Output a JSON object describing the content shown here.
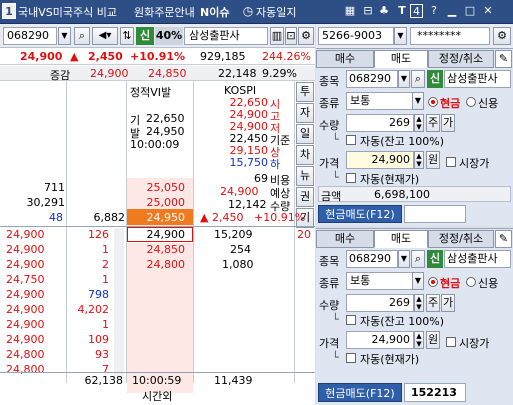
{
  "topbar": {
    "num": "1",
    "compare": "국내VS미국주식 비교",
    "won": "원화주문안내",
    "news": "N이슈",
    "autolog": "자동일지",
    "help_num": "4",
    "help_q": "?"
  },
  "left": {
    "code": "068290",
    "credit": "신",
    "pct": "40%",
    "name": "삼성출판사",
    "price": "24,900",
    "change": "2,450",
    "rate": "+10.91%",
    "volume": "929,185",
    "vol_rate": "244.26%",
    "label_change": "증감",
    "ask_px": "24,900",
    "bid_px": "24,850",
    "vol2": "22,148",
    "vol2_rate": "9.29%",
    "vi_title": "정적VI발",
    "vi_gi_label": "기",
    "vi_gi": "22,650",
    "vi_bal_label": "발",
    "vi_bal": "24,950",
    "vi_time": "10:00:09",
    "kospi": "KOSPI",
    "kospi_vals": [
      "22,650",
      "24,900",
      "24,900",
      "22,450",
      "29,150",
      "15,750",
      "69"
    ],
    "kospi_labels": [
      "시",
      "고",
      "저",
      "기준",
      "상",
      "하",
      "비용"
    ],
    "expected_label": "예상",
    "expected_val": "24,900",
    "qty_label": "수량",
    "qty_val": "12,142",
    "exp_change": "2,450",
    "exp_rate": "+10.91%",
    "side_tabs": [
      "투",
      "자",
      "일",
      "차",
      "뉴",
      "권",
      "기"
    ],
    "asks": [
      {
        "qty": "711",
        "price": "25,050"
      },
      {
        "qty": "30,291",
        "price": "25,000"
      },
      {
        "prev": "48",
        "qty": "6,882",
        "price": "24,950"
      }
    ],
    "current_price": "24,900",
    "current_qty": "15,209",
    "current_right": "20",
    "bids": [
      {
        "price": "24,850",
        "qty": "254"
      },
      {
        "price": "24,800",
        "qty": "1,080"
      }
    ],
    "ticks": [
      {
        "p": "24,900",
        "q": "126"
      },
      {
        "p": "24,900",
        "q": "1"
      },
      {
        "p": "24,900",
        "q": "2"
      },
      {
        "p": "24,750",
        "q": "1"
      },
      {
        "p": "24,900",
        "q": "798"
      },
      {
        "p": "24,900",
        "q": "4,202"
      },
      {
        "p": "24,900",
        "q": "1"
      },
      {
        "p": "24,900",
        "q": "109"
      },
      {
        "p": "24,800",
        "q": "93"
      },
      {
        "p": "24,800",
        "q": "7"
      }
    ],
    "total_ask": "62,138",
    "time": "10:00:59",
    "after_hours": "시간외",
    "total_bid": "11,439"
  },
  "order_top": {
    "account": "5266-9003",
    "password": "********",
    "tab_buy": "매수",
    "tab_sell": "매도",
    "tab_modify": "정정/취소",
    "label_code": "종목",
    "code": "068290",
    "credit": "신",
    "name": "삼성출판사",
    "label_type": "종류",
    "type": "보통",
    "radio_cash": "현금",
    "radio_credit": "신용",
    "label_qty": "수량",
    "qty": "269",
    "btn_ju": "주",
    "btn_ga": "가",
    "auto_qty": "자동(잔고 100%)",
    "label_price": "가격",
    "price": "24,900",
    "won": "원",
    "market_price": "시장가",
    "auto_price": "자동(현재가)",
    "label_amount": "금액",
    "amount": "6,698,100",
    "submit": "현금매도(F12)"
  },
  "order_bottom": {
    "tab_buy": "매수",
    "tab_sell": "매도",
    "tab_modify": "정정/취소",
    "label_code": "종목",
    "code": "068290",
    "credit": "신",
    "name": "삼성출판사",
    "label_type": "종류",
    "type": "보통",
    "radio_cash": "현금",
    "radio_credit": "신용",
    "label_qty": "수량",
    "qty": "269",
    "btn_ju": "주",
    "btn_ga": "가",
    "auto_qty": "자동(잔고 100%)",
    "label_price": "가격",
    "price": "24,900",
    "won": "원",
    "market_price": "시장가",
    "auto_price": "자동(현재가)",
    "submit": "현금매도(F12)",
    "order_no": "152213"
  }
}
